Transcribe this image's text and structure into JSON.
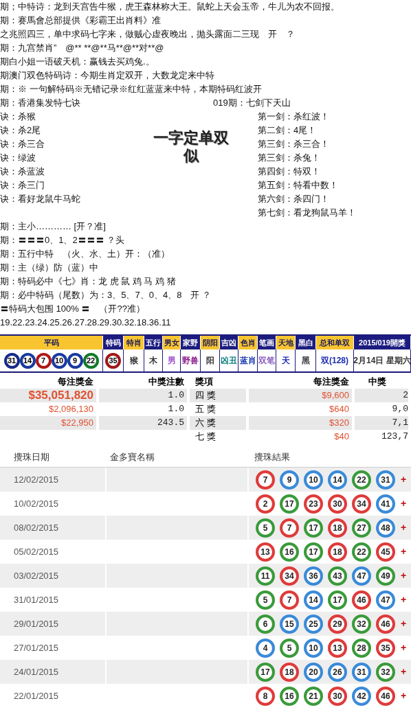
{
  "poems": [
    "期；中特诗：龙到天宫告牛猴，虎王森林称大王。鼠蛇上天会玉帝，牛儿为农不回报。",
    "期：赛馬會总部提供《彩霸王出肖料》准",
    "之兆照四三，单中求码七字来，做贼心虚夜晚出，抛头露面二三现　开　？",
    "期：九宫禁肖”　@**  **@**马**@**对**@",
    "期白小姐一语破天机：赢钱去买鸡兔.。",
    "期澳门双色特码诗：今期生肖定双开，大数龙定来中特",
    "期：※ 一句解特码※无错记录※红红蓝蓝来中特，本期特码红波开"
  ],
  "seven_title": "期：香港集发特七诀",
  "sword_title": "019期：七剑下天山",
  "seven": [
    "诀：杀猴",
    "诀：杀2尾",
    "诀：杀三合",
    "诀：绿波",
    "诀：杀蓝波",
    "诀：杀三门",
    "诀：看好龙鼠牛马蛇"
  ],
  "big_text": "一字定单双似",
  "swords": [
    "第一剑：杀红波！",
    "第二剑：4尾！",
    "第三剑：杀三合！",
    "第三剑：杀兔！",
    "第四剑：特双！",
    "第五剑：特看中数！",
    "第六剑：杀四门！",
    "第七剑：看龙狗鼠马羊！"
  ],
  "tips": [
    "期：主小………… [开？准]",
    "期：〓〓〓0、1、2〓〓〓 ？头",
    "期：五行中特　（火、水、土）开：（准）",
    "期：主（绿）防（蓝）中",
    "期：特码必中《七》肖：龙 虎 鼠 鸡 马 鸡 猪",
    "期：必中特码（尾数）为：3、5、7、0、4、8　开 ？",
    "〓特码大包围 100% 〓　（开??准）",
    "19.22.23.24.25.26.27.28.29.30.32.18.36.11"
  ],
  "draw_table": {
    "columns": [
      "平码",
      "特码",
      "特肖",
      "五行",
      "男女",
      "家野",
      "阴阳",
      "吉凶",
      "色肖",
      "笔画",
      "天地",
      "黑白",
      "总和单双",
      "2015/019開獎"
    ],
    "balls": [
      {
        "number": "31",
        "color": "#1a2a8a"
      },
      {
        "number": "14",
        "color": "#1a3aa0"
      },
      {
        "number": "7",
        "color": "#b01818"
      },
      {
        "number": "10",
        "color": "#1a3aa0"
      },
      {
        "number": "9",
        "color": "#1a3aa0"
      },
      {
        "number": "22",
        "color": "#117a2a"
      }
    ],
    "special": {
      "number": "35",
      "color": "#a01818"
    },
    "cells": [
      {
        "text": "猴",
        "color": "#333333"
      },
      {
        "text": "木",
        "color": "#333333"
      },
      {
        "text": "男",
        "color": "#a050d0"
      },
      {
        "text": "野兽",
        "color": "#8a1a8a"
      },
      {
        "text": "阳",
        "color": "#333333"
      },
      {
        "text": "凶丑",
        "color": "#108080"
      },
      {
        "text": "蓝肖",
        "color": "#1a3ab0"
      },
      {
        "text": "双笔",
        "color": "#8a60c0"
      },
      {
        "text": "天",
        "color": "#1a2ab0"
      },
      {
        "text": "黑",
        "color": "#333333"
      },
      {
        "text": "双(128)",
        "color": "#1a2ab0"
      },
      {
        "text": "2月14日 星期六",
        "color": "#333333"
      }
    ]
  },
  "prizes": {
    "left_columns": [
      "每注獎金",
      "中獎注數"
    ],
    "right_columns": [
      "獎項",
      "每注獎金",
      "中獎"
    ],
    "left_rows": [
      {
        "amount": "$35,051,820",
        "count": "1.0"
      },
      {
        "amount": "$2,096,130",
        "count": "1.0"
      },
      {
        "amount": "$22,950",
        "count": "243.5"
      }
    ],
    "right_rows": [
      {
        "prize": "四 獎",
        "amount": "$9,600",
        "count": "2"
      },
      {
        "prize": "五 獎",
        "amount": "$640",
        "count": "9,0"
      },
      {
        "prize": "六 獎",
        "amount": "$320",
        "count": "7,1"
      },
      {
        "prize": "七 獎",
        "amount": "$40",
        "count": "123,7"
      }
    ]
  },
  "results": {
    "columns": [
      "攪珠日期",
      "金多寶名稱",
      "攪珠結果"
    ],
    "rows": [
      {
        "date": "12/02/2015",
        "plus": "+",
        "balls": [
          {
            "number": "7",
            "color": "#e03a3a"
          },
          {
            "number": "9",
            "color": "#3a8ad8"
          },
          {
            "number": "10",
            "color": "#3a8ad8"
          },
          {
            "number": "14",
            "color": "#3a8ad8"
          },
          {
            "number": "22",
            "color": "#3a9a3a"
          },
          {
            "number": "31",
            "color": "#3a8ad8"
          }
        ]
      },
      {
        "date": "10/02/2015",
        "plus": "+",
        "balls": [
          {
            "number": "2",
            "color": "#e03a3a"
          },
          {
            "number": "17",
            "color": "#3a9a3a"
          },
          {
            "number": "23",
            "color": "#e03a3a"
          },
          {
            "number": "30",
            "color": "#e03a3a"
          },
          {
            "number": "34",
            "color": "#e03a3a"
          },
          {
            "number": "41",
            "color": "#3a8ad8"
          }
        ]
      },
      {
        "date": "08/02/2015",
        "plus": "+",
        "balls": [
          {
            "number": "5",
            "color": "#3a9a3a"
          },
          {
            "number": "7",
            "color": "#e03a3a"
          },
          {
            "number": "17",
            "color": "#3a9a3a"
          },
          {
            "number": "18",
            "color": "#e03a3a"
          },
          {
            "number": "27",
            "color": "#3a9a3a"
          },
          {
            "number": "48",
            "color": "#3a8ad8"
          }
        ]
      },
      {
        "date": "05/02/2015",
        "plus": "+",
        "balls": [
          {
            "number": "13",
            "color": "#e03a3a"
          },
          {
            "number": "16",
            "color": "#3a9a3a"
          },
          {
            "number": "17",
            "color": "#3a9a3a"
          },
          {
            "number": "18",
            "color": "#e03a3a"
          },
          {
            "number": "22",
            "color": "#3a9a3a"
          },
          {
            "number": "45",
            "color": "#e03a3a"
          }
        ]
      },
      {
        "date": "03/02/2015",
        "plus": "+",
        "balls": [
          {
            "number": "11",
            "color": "#3a9a3a"
          },
          {
            "number": "34",
            "color": "#e03a3a"
          },
          {
            "number": "36",
            "color": "#3a8ad8"
          },
          {
            "number": "43",
            "color": "#3a9a3a"
          },
          {
            "number": "47",
            "color": "#3a8ad8"
          },
          {
            "number": "49",
            "color": "#3a9a3a"
          }
        ]
      },
      {
        "date": "31/01/2015",
        "plus": "+",
        "balls": [
          {
            "number": "5",
            "color": "#3a9a3a"
          },
          {
            "number": "7",
            "color": "#e03a3a"
          },
          {
            "number": "14",
            "color": "#3a8ad8"
          },
          {
            "number": "17",
            "color": "#3a9a3a"
          },
          {
            "number": "46",
            "color": "#e03a3a"
          },
          {
            "number": "47",
            "color": "#3a8ad8"
          }
        ]
      },
      {
        "date": "29/01/2015",
        "plus": "+",
        "balls": [
          {
            "number": "6",
            "color": "#3a9a3a"
          },
          {
            "number": "15",
            "color": "#3a8ad8"
          },
          {
            "number": "25",
            "color": "#3a8ad8"
          },
          {
            "number": "29",
            "color": "#e03a3a"
          },
          {
            "number": "32",
            "color": "#3a9a3a"
          },
          {
            "number": "46",
            "color": "#e03a3a"
          }
        ]
      },
      {
        "date": "27/01/2015",
        "plus": "+",
        "balls": [
          {
            "number": "4",
            "color": "#3a8ad8"
          },
          {
            "number": "5",
            "color": "#3a9a3a"
          },
          {
            "number": "10",
            "color": "#3a8ad8"
          },
          {
            "number": "13",
            "color": "#e03a3a"
          },
          {
            "number": "28",
            "color": "#3a9a3a"
          },
          {
            "number": "35",
            "color": "#e03a3a"
          }
        ]
      },
      {
        "date": "24/01/2015",
        "plus": "+",
        "balls": [
          {
            "number": "17",
            "color": "#3a9a3a"
          },
          {
            "number": "18",
            "color": "#e03a3a"
          },
          {
            "number": "20",
            "color": "#3a8ad8"
          },
          {
            "number": "26",
            "color": "#3a8ad8"
          },
          {
            "number": "31",
            "color": "#3a8ad8"
          },
          {
            "number": "32",
            "color": "#3a9a3a"
          }
        ]
      },
      {
        "date": "22/01/2015",
        "plus": "+",
        "balls": [
          {
            "number": "8",
            "color": "#e03a3a"
          },
          {
            "number": "16",
            "color": "#3a9a3a"
          },
          {
            "number": "21",
            "color": "#3a9a3a"
          },
          {
            "number": "30",
            "color": "#e03a3a"
          },
          {
            "number": "42",
            "color": "#3a8ad8"
          },
          {
            "number": "46",
            "color": "#e03a3a"
          }
        ]
      }
    ]
  }
}
